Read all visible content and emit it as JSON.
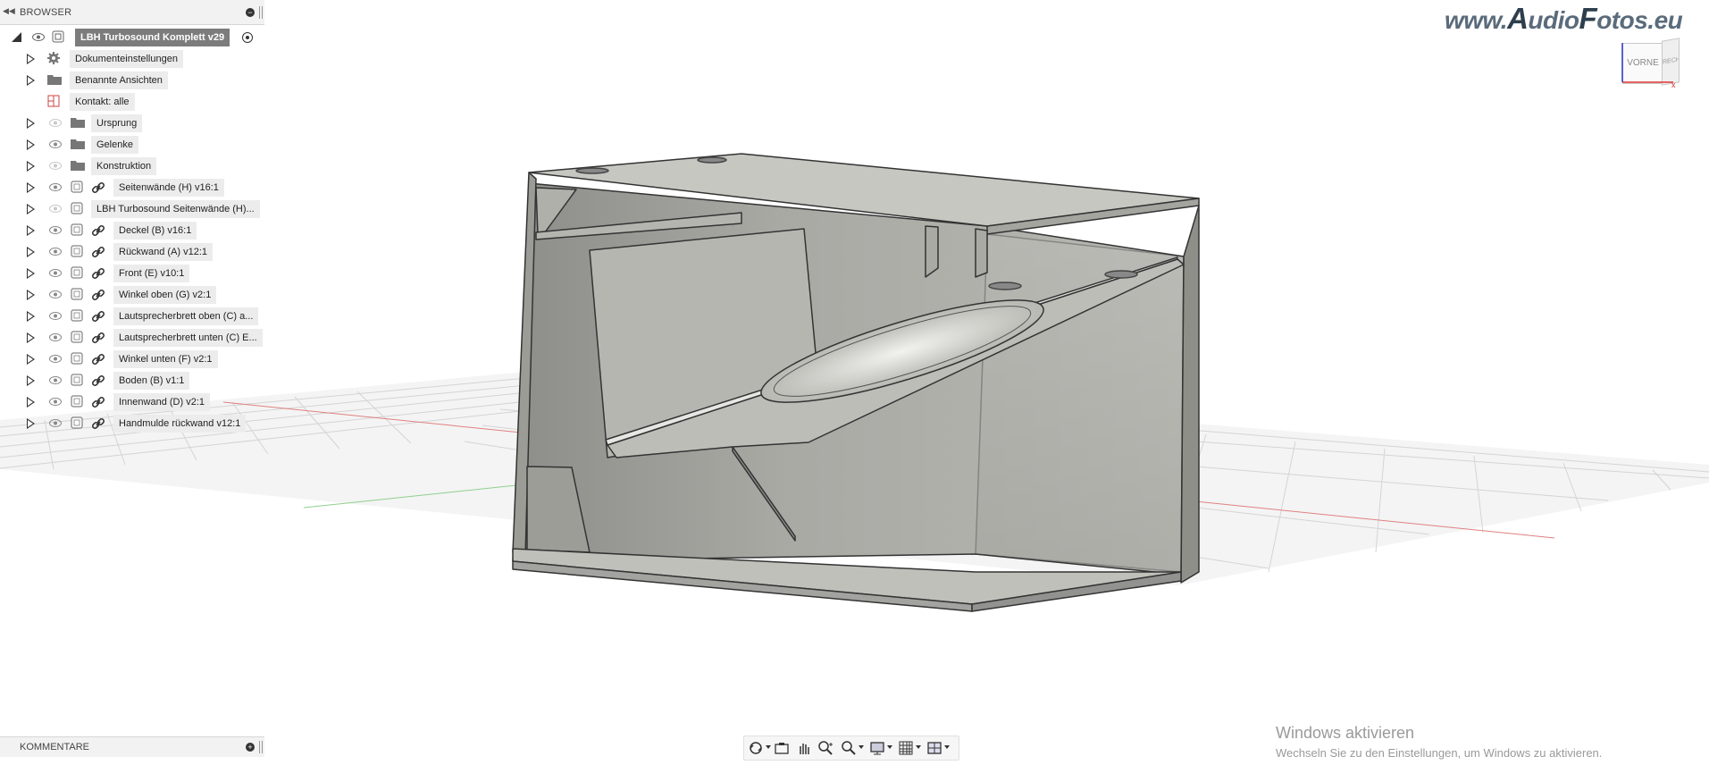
{
  "browser": {
    "title": "BROWSER",
    "root": {
      "label": "LBH Turbosound Komplett v29"
    },
    "items": [
      {
        "label": "Dokumenteinstellungen",
        "icon": "gear-icon",
        "expandable": true
      },
      {
        "label": "Benannte Ansichten",
        "icon": "folder-icon",
        "expandable": true
      },
      {
        "label": "Kontakt: alle",
        "icon": "contact-icon",
        "expandable": false
      },
      {
        "label": "Ursprung",
        "icon": "folder-icon",
        "expandable": true,
        "visible": false
      },
      {
        "label": "Gelenke",
        "icon": "folder-icon",
        "expandable": true,
        "visible": true
      },
      {
        "label": "Konstruktion",
        "icon": "folder-icon",
        "expandable": true,
        "visible": false
      },
      {
        "label": "Seitenwände (H) v16:1",
        "icon": "component-link-icon",
        "expandable": true
      },
      {
        "label": "LBH Turbosound Seitenwände (H)...",
        "icon": "component-icon",
        "expandable": true,
        "visible": false
      },
      {
        "label": "Deckel (B) v16:1",
        "icon": "component-link-icon",
        "expandable": true
      },
      {
        "label": "Rückwand (A) v12:1",
        "icon": "component-link-icon",
        "expandable": true
      },
      {
        "label": "Front (E) v10:1",
        "icon": "component-link-icon",
        "expandable": true
      },
      {
        "label": "Winkel oben (G) v2:1",
        "icon": "component-link-icon",
        "expandable": true
      },
      {
        "label": "Lautsprecherbrett oben (C) a...",
        "icon": "component-link-icon",
        "expandable": true
      },
      {
        "label": "Lautsprecherbrett unten (C) E...",
        "icon": "component-link-icon",
        "expandable": true
      },
      {
        "label": "Winkel unten (F) v2:1",
        "icon": "component-link-icon",
        "expandable": true
      },
      {
        "label": "Boden (B) v1:1",
        "icon": "component-link-icon",
        "expandable": true
      },
      {
        "label": "Innenwand (D) v2:1",
        "icon": "component-link-icon",
        "expandable": true
      },
      {
        "label": "Handmulde rückwand v12:1",
        "icon": "component-link-icon",
        "expandable": true
      }
    ]
  },
  "comments": {
    "title": "KOMMENTARE"
  },
  "watermark": {
    "prefix": "www.",
    "a": "A",
    "mid": "udio",
    "f": "F",
    "suffix": "otos.eu"
  },
  "viewcube": {
    "front": "VORNE",
    "right": "RECHTS"
  },
  "windows": {
    "title": "Windows aktivieren",
    "subtitle": "Wechseln Sie zu den Einstellungen, um Windows zu aktivieren."
  },
  "nav_toolbar": {
    "tools": [
      "orbit-icon",
      "look-at-icon",
      "pan-icon",
      "zoom-icon",
      "fit-icon",
      "display-settings-icon",
      "grid-icon",
      "viewports-icon"
    ]
  },
  "colors": {
    "accent_root": "#7c7c7c",
    "model_grey": "#a8a8a2",
    "grid": "#cfcfcf"
  }
}
